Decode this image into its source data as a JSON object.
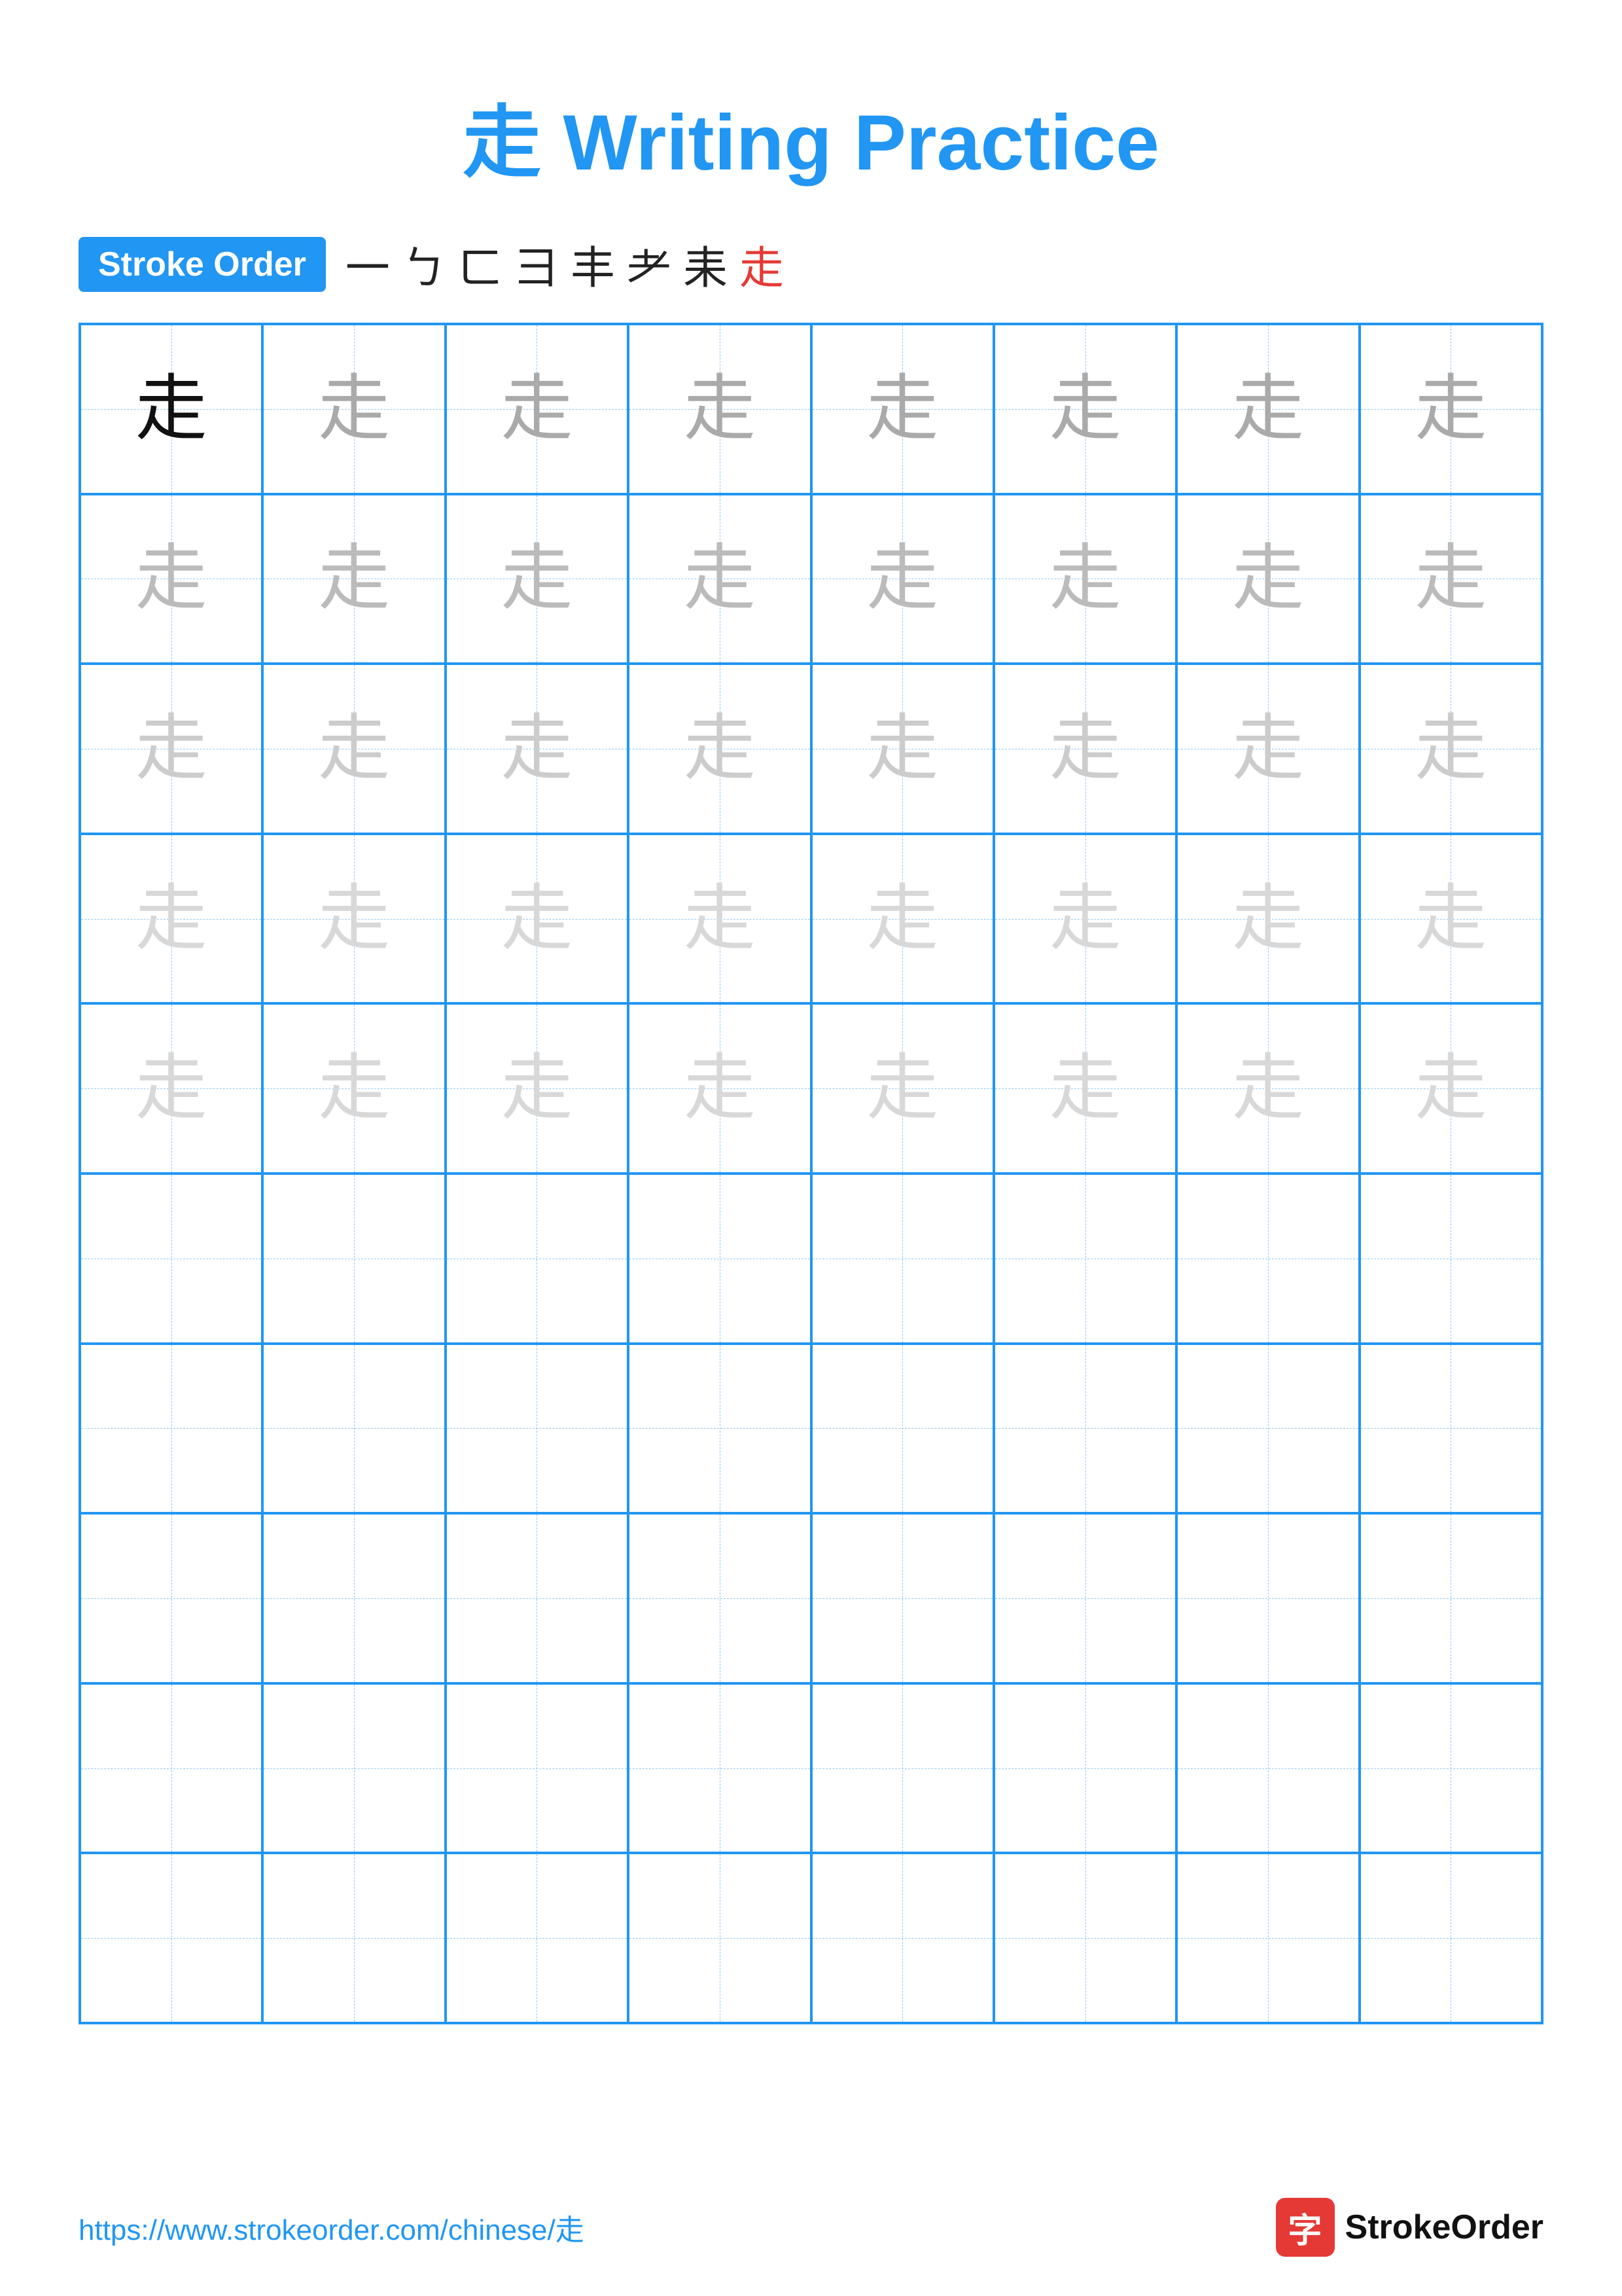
{
  "title": {
    "char": "走",
    "label": "Writing Practice",
    "full": "走 Writing Practice"
  },
  "stroke_order": {
    "badge_label": "Stroke Order",
    "strokes": [
      "一",
      "ㄅ",
      "ㄈ",
      "彐",
      "丰",
      "耂",
      "耒",
      "走"
    ],
    "stroke_colors": [
      "black",
      "black",
      "black",
      "black",
      "black",
      "black",
      "black",
      "red"
    ]
  },
  "grid": {
    "cols": 8,
    "rows": 10,
    "char": "走",
    "filled_rows": 5,
    "shades": [
      "black",
      "gray1",
      "gray2",
      "gray3",
      "gray4"
    ]
  },
  "footer": {
    "url": "https://www.strokeorder.com/chinese/走",
    "logo_char": "字",
    "logo_text": "StrokeOrder"
  }
}
